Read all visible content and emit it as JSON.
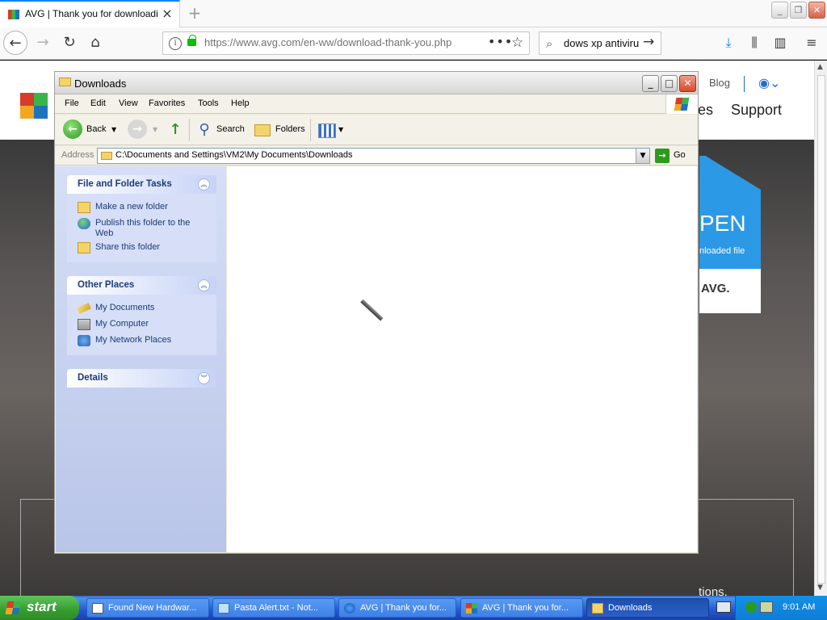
{
  "browser": {
    "tab_title": "AVG | Thank you for downloading",
    "new_tab_symbol": "+",
    "url": "https://www.avg.com/en-ww/download-thank-you.php",
    "search_text": "dows xp antiviru"
  },
  "page": {
    "blog": "Blog",
    "support": "Support",
    "partial_nav": "es",
    "promo_title": "PEN",
    "promo_sub": "nloaded file",
    "promo_brand": "AVG.",
    "body_text": "tions."
  },
  "explorer": {
    "title": "Downloads",
    "menu": [
      "File",
      "Edit",
      "View",
      "Favorites",
      "Tools",
      "Help"
    ],
    "toolbar": {
      "back": "Back",
      "search": "Search",
      "folders": "Folders"
    },
    "address_label": "Address",
    "address_path": "C:\\Documents and Settings\\VM2\\My Documents\\Downloads",
    "go_label": "Go",
    "panels": {
      "file_tasks": {
        "title": "File and Folder Tasks",
        "items": [
          "Make a new folder",
          "Publish this folder to the Web",
          "Share this folder"
        ]
      },
      "other_places": {
        "title": "Other Places",
        "items": [
          "My Documents",
          "My Computer",
          "My Network Places"
        ]
      },
      "details": {
        "title": "Details"
      }
    }
  },
  "taskbar": {
    "start": "start",
    "tasks": [
      "Found New Hardwar...",
      "Pasta Alert.txt - Not...",
      "AVG | Thank you for...",
      "AVG | Thank you for...",
      "Downloads"
    ],
    "clock": "9:01 AM"
  },
  "colors": {
    "xp_blue": "#0054e3",
    "start_green": "#379c2f",
    "firefox_accent": "#0a84ff",
    "avg_promo_blue": "#2b99e6"
  }
}
